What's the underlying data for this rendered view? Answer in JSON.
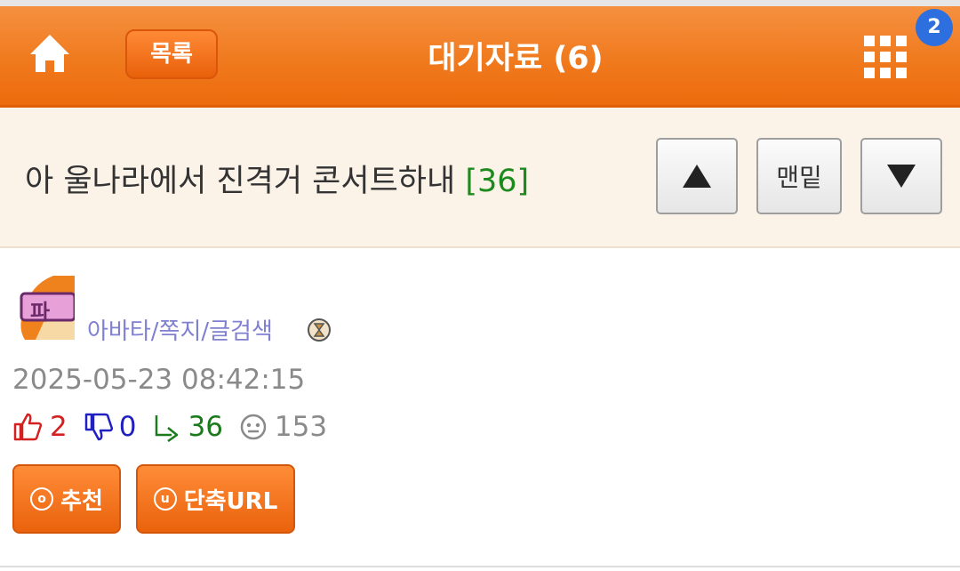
{
  "header": {
    "list_label": "목록",
    "title": "대기자료 (6)",
    "badge_count": "2"
  },
  "subject": {
    "text": "아 울나라에서 진격거 콘서트하내 ",
    "count": "[36]"
  },
  "nav": {
    "bottom_label": "맨밑"
  },
  "author": {
    "avatar_text": "파",
    "links": "아바타/쪽지/글검색"
  },
  "post": {
    "datetime": "2025-05-23 08:42:15",
    "stats": {
      "recommend": "2",
      "oppose": "0",
      "replies": "36",
      "views": "153"
    }
  },
  "actions": {
    "recommend_icon": "o",
    "recommend_label": "추천",
    "short_url_icon": "u",
    "short_url_label": "단축URL"
  },
  "colors": {
    "header_orange": "#f07a1e",
    "reply_count_green": "#1c8a1c",
    "recommend_red": "#d32020",
    "oppose_blue": "#2020c0"
  }
}
